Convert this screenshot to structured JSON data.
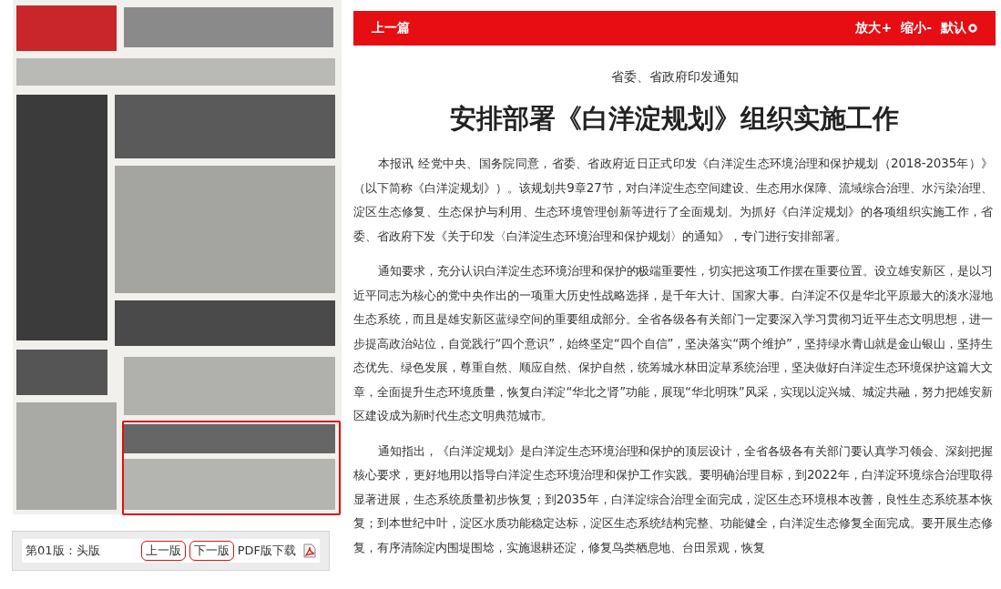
{
  "page_nav": {
    "page_label": "第01版：头版",
    "buttons": [
      "上一版",
      "下一版"
    ],
    "pdf_link": "PDF版下载"
  },
  "toolbar": {
    "prev_article": "上一篇",
    "zoom_in": "放大+",
    "zoom_out": "缩小-",
    "reset": "默认"
  },
  "article": {
    "kicker": "省委、省政府印发通知",
    "title": "安排部署《白洋淀规划》组织实施工作",
    "paragraphs": [
      "本报讯 经党中央、国务院同意，省委、省政府近日正式印发《白洋淀生态环境治理和保护规划（2018-2035年）》（以下简称《白洋淀规划》）。该规划共9章27节，对白洋淀生态空间建设、生态用水保障、流域综合治理、水污染治理、淀区生态修复、生态保护与利用、生态环境管理创新等进行了全面规划。为抓好《白洋淀规划》的各项组织实施工作，省委、省政府下发《关于印发〈白洋淀生态环境治理和保护规划〉的通知》，专门进行安排部署。",
      "通知要求，充分认识白洋淀生态环境治理和保护的极端重要性，切实把这项工作摆在重要位置。设立雄安新区，是以习近平同志为核心的党中央作出的一项重大历史性战略选择，是千年大计、国家大事。白洋淀不仅是华北平原最大的淡水湿地生态系统，而且是雄安新区蓝绿空间的重要组成部分。全省各级各有关部门一定要深入学习贯彻习近平生态文明思想，进一步提高政治站位，自觉践行“四个意识”，始终坚定“四个自信”，坚决落实“两个维护”，坚持绿水青山就是金山银山，坚持生态优先、绿色发展，尊重自然、顺应自然、保护自然，统筹城水林田淀草系统治理，坚决做好白洋淀生态环境保护这篇大文章，全面提升生态环境质量，恢复白洋淀“华北之肾”功能，展现“华北明珠”风采，实现以淀兴城、城淀共融，努力把雄安新区建设成为新时代生态文明典范城市。",
      "通知指出，《白洋淀规划》是白洋淀生态环境治理和保护的顶层设计，全省各级各有关部门要认真学习领会、深刻把握核心要求，更好地用以指导白洋淀生态环境治理和保护工作实践。要明确治理目标，到2022年，白洋淀环境综合治理取得显著进展，生态系统质量初步恢复；到2035年，白洋淀综合治理全面完成，淀区生态环境根本改善，良性生态系统基本恢复；到本世纪中叶，淀区水质功能稳定达标，淀区生态系统结构完整、功能健全，白洋淀生态修复全面完成。要开展生态修复，有序清除淀内围堤围埝，实施退耕还淀，修复鸟类栖息地、台田景观，恢复"
    ]
  }
}
